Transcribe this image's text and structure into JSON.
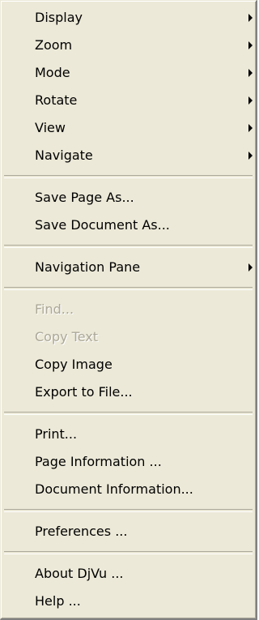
{
  "menu": {
    "groups": [
      {
        "items": [
          {
            "label": "Display",
            "submenu": true,
            "enabled": true
          },
          {
            "label": "Zoom",
            "submenu": true,
            "enabled": true
          },
          {
            "label": "Mode",
            "submenu": true,
            "enabled": true
          },
          {
            "label": "Rotate",
            "submenu": true,
            "enabled": true
          },
          {
            "label": "View",
            "submenu": true,
            "enabled": true
          },
          {
            "label": "Navigate",
            "submenu": true,
            "enabled": true
          }
        ]
      },
      {
        "items": [
          {
            "label": "Save Page As...",
            "submenu": false,
            "enabled": true
          },
          {
            "label": "Save Document As...",
            "submenu": false,
            "enabled": true
          }
        ]
      },
      {
        "items": [
          {
            "label": "Navigation Pane",
            "submenu": true,
            "enabled": true
          }
        ]
      },
      {
        "items": [
          {
            "label": "Find...",
            "submenu": false,
            "enabled": false
          },
          {
            "label": "Copy Text",
            "submenu": false,
            "enabled": false
          },
          {
            "label": "Copy Image",
            "submenu": false,
            "enabled": true
          },
          {
            "label": "Export to File...",
            "submenu": false,
            "enabled": true
          }
        ]
      },
      {
        "items": [
          {
            "label": "Print...",
            "submenu": false,
            "enabled": true
          },
          {
            "label": "Page Information ...",
            "submenu": false,
            "enabled": true
          },
          {
            "label": "Document Information...",
            "submenu": false,
            "enabled": true
          }
        ]
      },
      {
        "items": [
          {
            "label": "Preferences ...",
            "submenu": false,
            "enabled": true
          }
        ]
      },
      {
        "items": [
          {
            "label": "About DjVu ...",
            "submenu": false,
            "enabled": true
          },
          {
            "label": "Help ...",
            "submenu": false,
            "enabled": true
          }
        ]
      }
    ],
    "colors": {
      "background": "#ece9d8",
      "text": "#000000",
      "disabled_text": "#aca899",
      "separator_dark": "#aca899",
      "separator_light": "#ffffff"
    },
    "icons": {
      "submenu": "submenu-arrow-icon"
    }
  }
}
